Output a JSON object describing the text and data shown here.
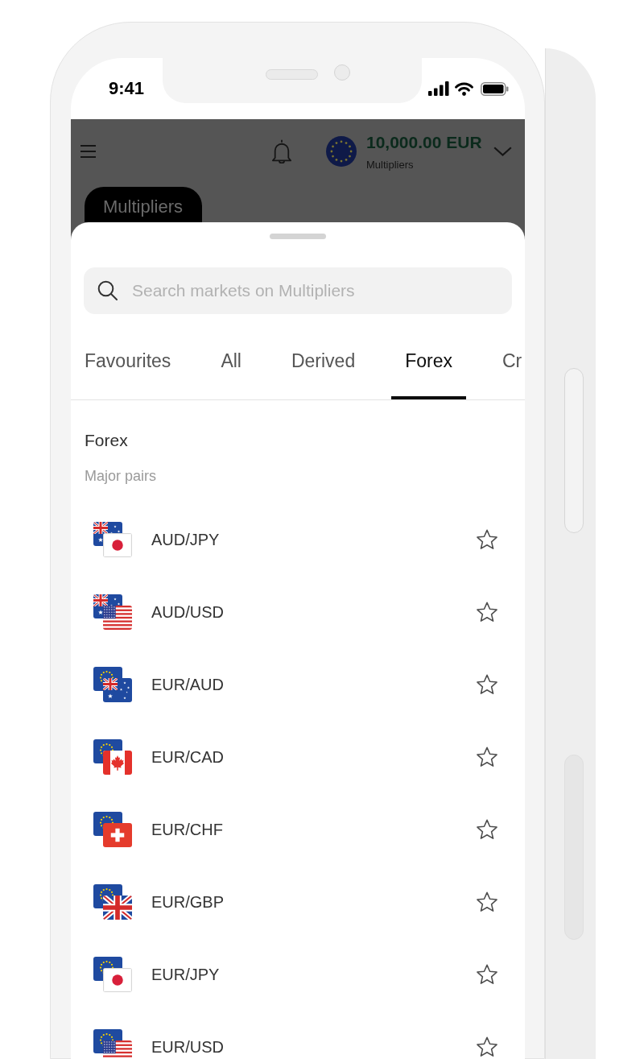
{
  "status_bar": {
    "time": "9:41"
  },
  "header": {
    "balance": "10,000.00 EUR",
    "account_type": "Multipliers",
    "category_chip": "Multipliers"
  },
  "search": {
    "placeholder": "Search markets on Multipliers"
  },
  "tabs": [
    {
      "label": "Favourites",
      "selected": false
    },
    {
      "label": "All",
      "selected": false
    },
    {
      "label": "Derived",
      "selected": false
    },
    {
      "label": "Forex",
      "selected": true
    },
    {
      "label": "Cr",
      "selected": false
    }
  ],
  "section": {
    "title": "Forex",
    "subtitle": "Major pairs"
  },
  "markets": [
    {
      "name": "AUD/JPY",
      "flags": [
        {
          "kind": "australia"
        },
        {
          "kind": "japan"
        }
      ],
      "starred": false
    },
    {
      "name": "AUD/USD",
      "flags": [
        {
          "kind": "australia"
        },
        {
          "kind": "usa"
        }
      ],
      "starred": false
    },
    {
      "name": "EUR/AUD",
      "flags": [
        {
          "kind": "eu"
        },
        {
          "kind": "australia"
        }
      ],
      "starred": false
    },
    {
      "name": "EUR/CAD",
      "flags": [
        {
          "kind": "eu"
        },
        {
          "kind": "canada"
        }
      ],
      "starred": false
    },
    {
      "name": "EUR/CHF",
      "flags": [
        {
          "kind": "eu"
        },
        {
          "kind": "switzerland"
        }
      ],
      "starred": false
    },
    {
      "name": "EUR/GBP",
      "flags": [
        {
          "kind": "eu"
        },
        {
          "kind": "uk"
        }
      ],
      "starred": false
    },
    {
      "name": "EUR/JPY",
      "flags": [
        {
          "kind": "eu"
        },
        {
          "kind": "japan"
        }
      ],
      "starred": false
    },
    {
      "name": "EUR/USD",
      "flags": [
        {
          "kind": "eu"
        },
        {
          "kind": "usa"
        }
      ],
      "starred": false
    }
  ]
}
